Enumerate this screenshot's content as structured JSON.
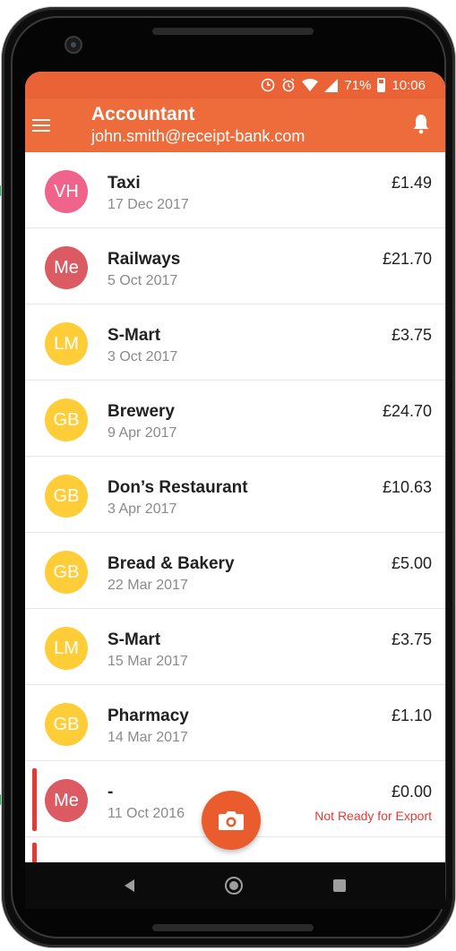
{
  "colors": {
    "primary": "#ee6c3c",
    "status_bar": "#ea6336",
    "warning": "#e53935",
    "avatar_colors": {
      "pink": "#f0648b",
      "red": "#dc5b62",
      "yellow": "#ffcd38"
    }
  },
  "status_bar": {
    "battery": "71%",
    "time": "10:06",
    "icons": [
      "sync-icon",
      "alarm-icon",
      "wifi-icon",
      "signal-icon",
      "battery-icon"
    ]
  },
  "app_bar": {
    "title": "Accountant",
    "subtitle": "john.smith@receipt-bank.com",
    "icons": [
      "menu-icon",
      "bell-icon"
    ]
  },
  "receipts": [
    {
      "initials": "VH",
      "color": "#f0648b",
      "merchant": "Taxi",
      "date": "17 Dec 2017",
      "amount": "£1.49",
      "status": ""
    },
    {
      "initials": "Me",
      "color": "#dc5b62",
      "merchant": "Railways",
      "date": "5 Oct 2017",
      "amount": "£21.70",
      "status": ""
    },
    {
      "initials": "LM",
      "color": "#ffcd38",
      "merchant": "S-Mart",
      "date": "3 Oct 2017",
      "amount": "£3.75",
      "status": ""
    },
    {
      "initials": "GB",
      "color": "#ffcd38",
      "merchant": "Brewery",
      "date": "9 Apr 2017",
      "amount": "£24.70",
      "status": ""
    },
    {
      "initials": "GB",
      "color": "#ffcd38",
      "merchant": "Don’s Restaurant",
      "date": "3 Apr 2017",
      "amount": "£10.63",
      "status": ""
    },
    {
      "initials": "GB",
      "color": "#ffcd38",
      "merchant": "Bread & Bakery",
      "date": "22 Mar 2017",
      "amount": "£5.00",
      "status": ""
    },
    {
      "initials": "LM",
      "color": "#ffcd38",
      "merchant": "S-Mart",
      "date": "15 Mar 2017",
      "amount": "£3.75",
      "status": ""
    },
    {
      "initials": "GB",
      "color": "#ffcd38",
      "merchant": "Pharmacy",
      "date": "14 Mar 2017",
      "amount": "£1.10",
      "status": ""
    },
    {
      "initials": "Me",
      "color": "#dc5b62",
      "merchant": "-",
      "date": "11 Oct 2016",
      "amount": "£0.00",
      "status": "Not Ready for Export"
    }
  ],
  "fab": {
    "icon": "camera-icon"
  },
  "nav_bar": {
    "icons": [
      "back-icon",
      "home-icon",
      "recents-icon"
    ]
  }
}
